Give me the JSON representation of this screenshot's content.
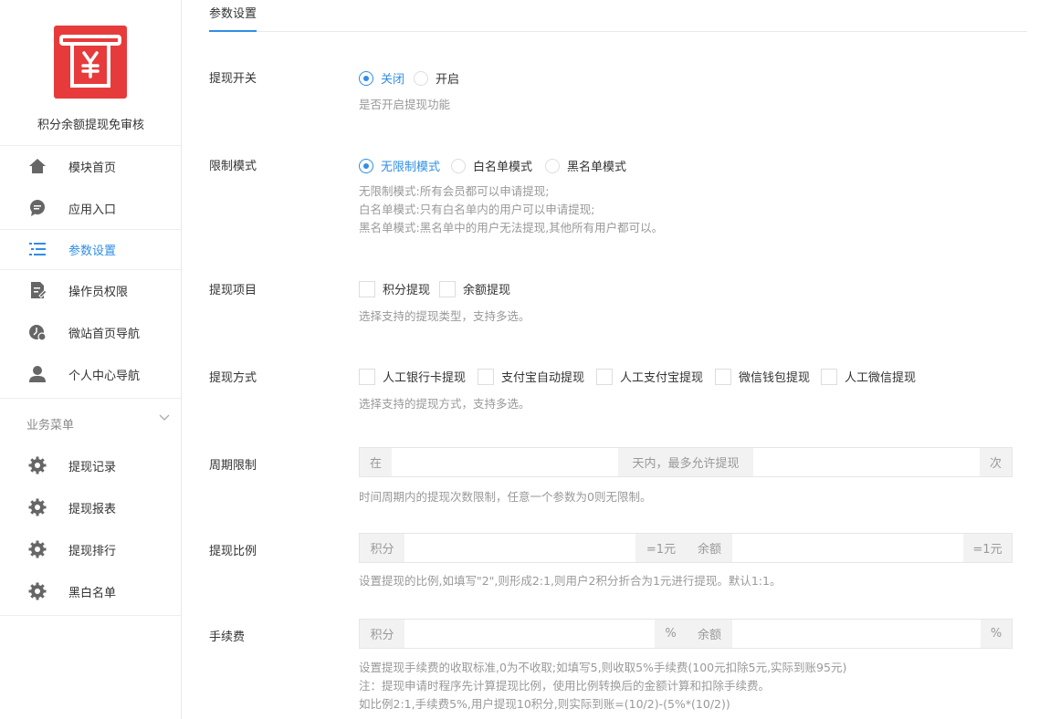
{
  "sidebar": {
    "module_name": "积分余额提现免审核",
    "items": [
      {
        "label": "模块首页",
        "icon": "home-icon"
      },
      {
        "label": "应用入口",
        "icon": "chat-icon"
      },
      {
        "label": "参数设置",
        "icon": "settings-list-icon",
        "active": true
      },
      {
        "label": "操作员权限",
        "icon": "edit-doc-icon"
      },
      {
        "label": "微站首页导航",
        "icon": "clock-icon"
      },
      {
        "label": "个人中心导航",
        "icon": "user-icon"
      }
    ],
    "section_title": "业务菜单",
    "business_items": [
      {
        "label": "提现记录",
        "icon": "gear-icon"
      },
      {
        "label": "提现报表",
        "icon": "gear-icon"
      },
      {
        "label": "提现排行",
        "icon": "gear-icon"
      },
      {
        "label": "黑白名单",
        "icon": "gear-icon"
      }
    ]
  },
  "tab": {
    "label": "参数设置"
  },
  "form": {
    "switch": {
      "label": "提现开关",
      "options": [
        "关闭",
        "开启"
      ],
      "selected": "关闭",
      "help": "是否开启提现功能"
    },
    "mode": {
      "label": "限制模式",
      "options": [
        "无限制模式",
        "白名单模式",
        "黑名单模式"
      ],
      "selected": "无限制模式",
      "help": [
        "无限制模式:所有会员都可以申请提现;",
        "白名单模式:只有白名单内的用户可以申请提现;",
        "黑名单模式:黑名单中的用户无法提现,其他所有用户都可以。"
      ]
    },
    "items": {
      "label": "提现项目",
      "options": [
        "积分提现",
        "余额提现"
      ],
      "help": "选择支持的提现类型，支持多选。"
    },
    "methods": {
      "label": "提现方式",
      "options": [
        "人工银行卡提现",
        "支付宝自动提现",
        "人工支付宝提现",
        "微信钱包提现",
        "人工微信提现"
      ],
      "help": "选择支持的提现方式，支持多选。"
    },
    "period": {
      "label": "周期限制",
      "prefix": "在",
      "middle": "天内，最多允许提现",
      "suffix": "次",
      "days_value": "",
      "times_value": "",
      "help": "时间周期内的提现次数限制，任意一个参数为0则无限制。"
    },
    "ratio": {
      "label": "提现比例",
      "addon1": "积分",
      "addon2": "=1元",
      "addon3": "余额",
      "addon4": "=1元",
      "points_value": "",
      "balance_value": "",
      "help": "设置提现的比例,如填写\"2\",则形成2:1,则用户2积分折合为1元进行提现。默认1:1。"
    },
    "fee": {
      "label": "手续费",
      "addon1": "积分",
      "addon2": "%",
      "addon3": "余额",
      "addon4": "%",
      "points_value": "",
      "balance_value": "",
      "help": [
        "设置提现手续费的收取标准,0为不收取;如填写5,则收取5%手续费(100元扣除5元,实际到账95元)",
        "注：提现申请时程序先计算提现比例，使用比例转换后的金额计算和扣除手续费。",
        "如比例2:1,手续费5%,用户提现10积分,则实际到账=(10/2)-(5%*(10/2))"
      ]
    }
  },
  "colors": {
    "accent": "#2f8ee6",
    "logo_bg": "#e73b3b",
    "help_text": "#999999"
  }
}
